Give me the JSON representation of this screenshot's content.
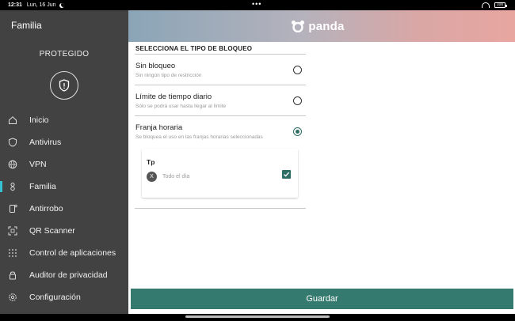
{
  "status_bar": {
    "time": "12:31",
    "date": "Lun, 16 Jun",
    "center": "•••",
    "battery": "100"
  },
  "sidebar": {
    "title": "Familia",
    "status": "PROTEGIDO",
    "items": [
      {
        "label": "Inicio",
        "icon": "home-icon",
        "active": false
      },
      {
        "label": "Antivirus",
        "icon": "shield-icon",
        "active": false
      },
      {
        "label": "VPN",
        "icon": "globe-icon",
        "active": false
      },
      {
        "label": "Familia",
        "icon": "family-icon",
        "active": true
      },
      {
        "label": "Antirrobo",
        "icon": "phone-icon",
        "active": false
      },
      {
        "label": "QR Scanner",
        "icon": "qr-icon",
        "active": false
      },
      {
        "label": "Control de aplicaciones",
        "icon": "grid-icon",
        "active": false
      },
      {
        "label": "Auditor de privacidad",
        "icon": "lock-icon",
        "active": false
      },
      {
        "label": "Configuración",
        "icon": "gear-icon",
        "active": false
      }
    ]
  },
  "banner": {
    "brand": "panda"
  },
  "block": {
    "section_title": "SELECCIONA EL TIPO DE BLOQUEO",
    "options": [
      {
        "title": "Sin bloqueo",
        "desc": "Sin ningún tipo de restricción",
        "selected": false
      },
      {
        "title": "Límite de tiempo diario",
        "desc": "Sólo se podrá usar hasta llegar al límite",
        "selected": false
      },
      {
        "title": "Franja horaria",
        "desc": "Se bloquea el uso en las franjas horarias seleccionadas",
        "selected": true
      }
    ],
    "schedule": {
      "name": "Tp",
      "badge": "X",
      "sub": "Todo el día",
      "checked": true
    }
  },
  "actions": {
    "save_label": "Guardar"
  },
  "colors": {
    "sidebar_bg": "#424242",
    "accent": "#357a6e",
    "active_indicator": "#36c1d0"
  }
}
